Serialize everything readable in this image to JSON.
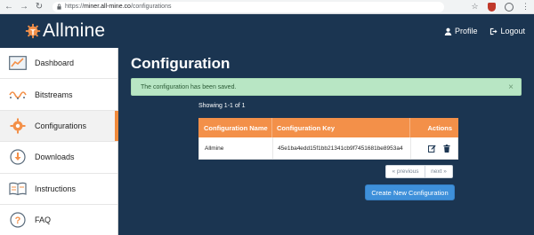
{
  "browser": {
    "url_scheme": "https://",
    "url_host": "miner.all-mine.co",
    "url_path": "/configurations"
  },
  "header": {
    "brand": "Allmine",
    "profile_label": "Profile",
    "logout_label": "Logout"
  },
  "sidebar": {
    "items": [
      {
        "label": "Dashboard",
        "icon": "chart-line-icon"
      },
      {
        "label": "Bitstreams",
        "icon": "bitstream-wave-icon"
      },
      {
        "label": "Configurations",
        "icon": "gear-icon",
        "active": true
      },
      {
        "label": "Downloads",
        "icon": "download-icon"
      },
      {
        "label": "Instructions",
        "icon": "book-icon"
      },
      {
        "label": "FAQ",
        "icon": "question-icon"
      }
    ]
  },
  "main": {
    "title": "Configuration",
    "alert_text": "The configuration has been saved.",
    "alert_close": "×",
    "showing_text": "Showing 1-1 of 1",
    "table": {
      "headers": [
        "Configuration Name",
        "Configuration Key",
        "Actions"
      ],
      "rows": [
        {
          "name": "Allmine",
          "key": "45e1ba4edd15f1bb21341cb9f7451681be8953a4"
        }
      ]
    },
    "pager": {
      "prev": "« previous",
      "next": "next »"
    },
    "create_button": "Create New Configuration"
  },
  "colors": {
    "navy": "#1b3551",
    "accent_orange": "#f39049",
    "alert_green": "#b8e6c4",
    "button_blue": "#3e90da"
  }
}
